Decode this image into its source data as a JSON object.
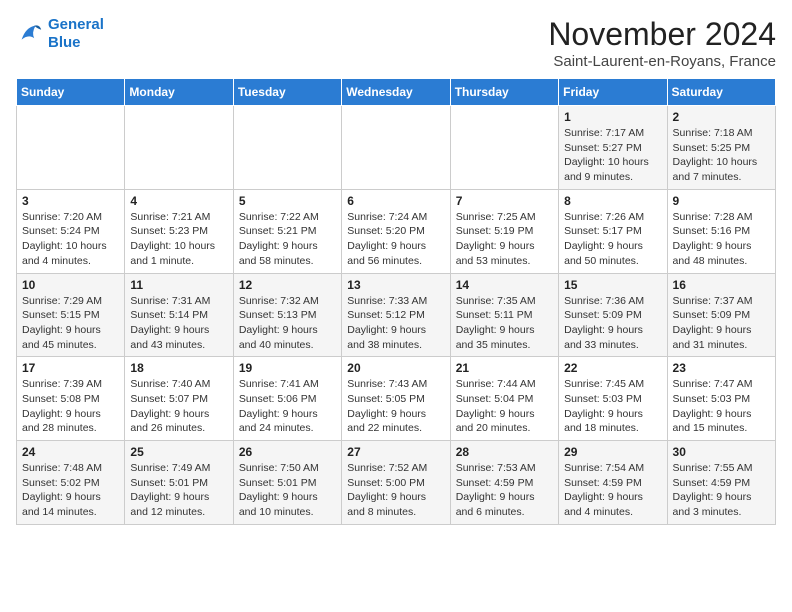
{
  "logo": {
    "line1": "General",
    "line2": "Blue"
  },
  "title": "November 2024",
  "subtitle": "Saint-Laurent-en-Royans, France",
  "weekdays": [
    "Sunday",
    "Monday",
    "Tuesday",
    "Wednesday",
    "Thursday",
    "Friday",
    "Saturday"
  ],
  "weeks": [
    [
      {
        "day": "",
        "info": ""
      },
      {
        "day": "",
        "info": ""
      },
      {
        "day": "",
        "info": ""
      },
      {
        "day": "",
        "info": ""
      },
      {
        "day": "",
        "info": ""
      },
      {
        "day": "1",
        "info": "Sunrise: 7:17 AM\nSunset: 5:27 PM\nDaylight: 10 hours and 9 minutes."
      },
      {
        "day": "2",
        "info": "Sunrise: 7:18 AM\nSunset: 5:25 PM\nDaylight: 10 hours and 7 minutes."
      }
    ],
    [
      {
        "day": "3",
        "info": "Sunrise: 7:20 AM\nSunset: 5:24 PM\nDaylight: 10 hours and 4 minutes."
      },
      {
        "day": "4",
        "info": "Sunrise: 7:21 AM\nSunset: 5:23 PM\nDaylight: 10 hours and 1 minute."
      },
      {
        "day": "5",
        "info": "Sunrise: 7:22 AM\nSunset: 5:21 PM\nDaylight: 9 hours and 58 minutes."
      },
      {
        "day": "6",
        "info": "Sunrise: 7:24 AM\nSunset: 5:20 PM\nDaylight: 9 hours and 56 minutes."
      },
      {
        "day": "7",
        "info": "Sunrise: 7:25 AM\nSunset: 5:19 PM\nDaylight: 9 hours and 53 minutes."
      },
      {
        "day": "8",
        "info": "Sunrise: 7:26 AM\nSunset: 5:17 PM\nDaylight: 9 hours and 50 minutes."
      },
      {
        "day": "9",
        "info": "Sunrise: 7:28 AM\nSunset: 5:16 PM\nDaylight: 9 hours and 48 minutes."
      }
    ],
    [
      {
        "day": "10",
        "info": "Sunrise: 7:29 AM\nSunset: 5:15 PM\nDaylight: 9 hours and 45 minutes."
      },
      {
        "day": "11",
        "info": "Sunrise: 7:31 AM\nSunset: 5:14 PM\nDaylight: 9 hours and 43 minutes."
      },
      {
        "day": "12",
        "info": "Sunrise: 7:32 AM\nSunset: 5:13 PM\nDaylight: 9 hours and 40 minutes."
      },
      {
        "day": "13",
        "info": "Sunrise: 7:33 AM\nSunset: 5:12 PM\nDaylight: 9 hours and 38 minutes."
      },
      {
        "day": "14",
        "info": "Sunrise: 7:35 AM\nSunset: 5:11 PM\nDaylight: 9 hours and 35 minutes."
      },
      {
        "day": "15",
        "info": "Sunrise: 7:36 AM\nSunset: 5:09 PM\nDaylight: 9 hours and 33 minutes."
      },
      {
        "day": "16",
        "info": "Sunrise: 7:37 AM\nSunset: 5:09 PM\nDaylight: 9 hours and 31 minutes."
      }
    ],
    [
      {
        "day": "17",
        "info": "Sunrise: 7:39 AM\nSunset: 5:08 PM\nDaylight: 9 hours and 28 minutes."
      },
      {
        "day": "18",
        "info": "Sunrise: 7:40 AM\nSunset: 5:07 PM\nDaylight: 9 hours and 26 minutes."
      },
      {
        "day": "19",
        "info": "Sunrise: 7:41 AM\nSunset: 5:06 PM\nDaylight: 9 hours and 24 minutes."
      },
      {
        "day": "20",
        "info": "Sunrise: 7:43 AM\nSunset: 5:05 PM\nDaylight: 9 hours and 22 minutes."
      },
      {
        "day": "21",
        "info": "Sunrise: 7:44 AM\nSunset: 5:04 PM\nDaylight: 9 hours and 20 minutes."
      },
      {
        "day": "22",
        "info": "Sunrise: 7:45 AM\nSunset: 5:03 PM\nDaylight: 9 hours and 18 minutes."
      },
      {
        "day": "23",
        "info": "Sunrise: 7:47 AM\nSunset: 5:03 PM\nDaylight: 9 hours and 15 minutes."
      }
    ],
    [
      {
        "day": "24",
        "info": "Sunrise: 7:48 AM\nSunset: 5:02 PM\nDaylight: 9 hours and 14 minutes."
      },
      {
        "day": "25",
        "info": "Sunrise: 7:49 AM\nSunset: 5:01 PM\nDaylight: 9 hours and 12 minutes."
      },
      {
        "day": "26",
        "info": "Sunrise: 7:50 AM\nSunset: 5:01 PM\nDaylight: 9 hours and 10 minutes."
      },
      {
        "day": "27",
        "info": "Sunrise: 7:52 AM\nSunset: 5:00 PM\nDaylight: 9 hours and 8 minutes."
      },
      {
        "day": "28",
        "info": "Sunrise: 7:53 AM\nSunset: 4:59 PM\nDaylight: 9 hours and 6 minutes."
      },
      {
        "day": "29",
        "info": "Sunrise: 7:54 AM\nSunset: 4:59 PM\nDaylight: 9 hours and 4 minutes."
      },
      {
        "day": "30",
        "info": "Sunrise: 7:55 AM\nSunset: 4:59 PM\nDaylight: 9 hours and 3 minutes."
      }
    ]
  ]
}
